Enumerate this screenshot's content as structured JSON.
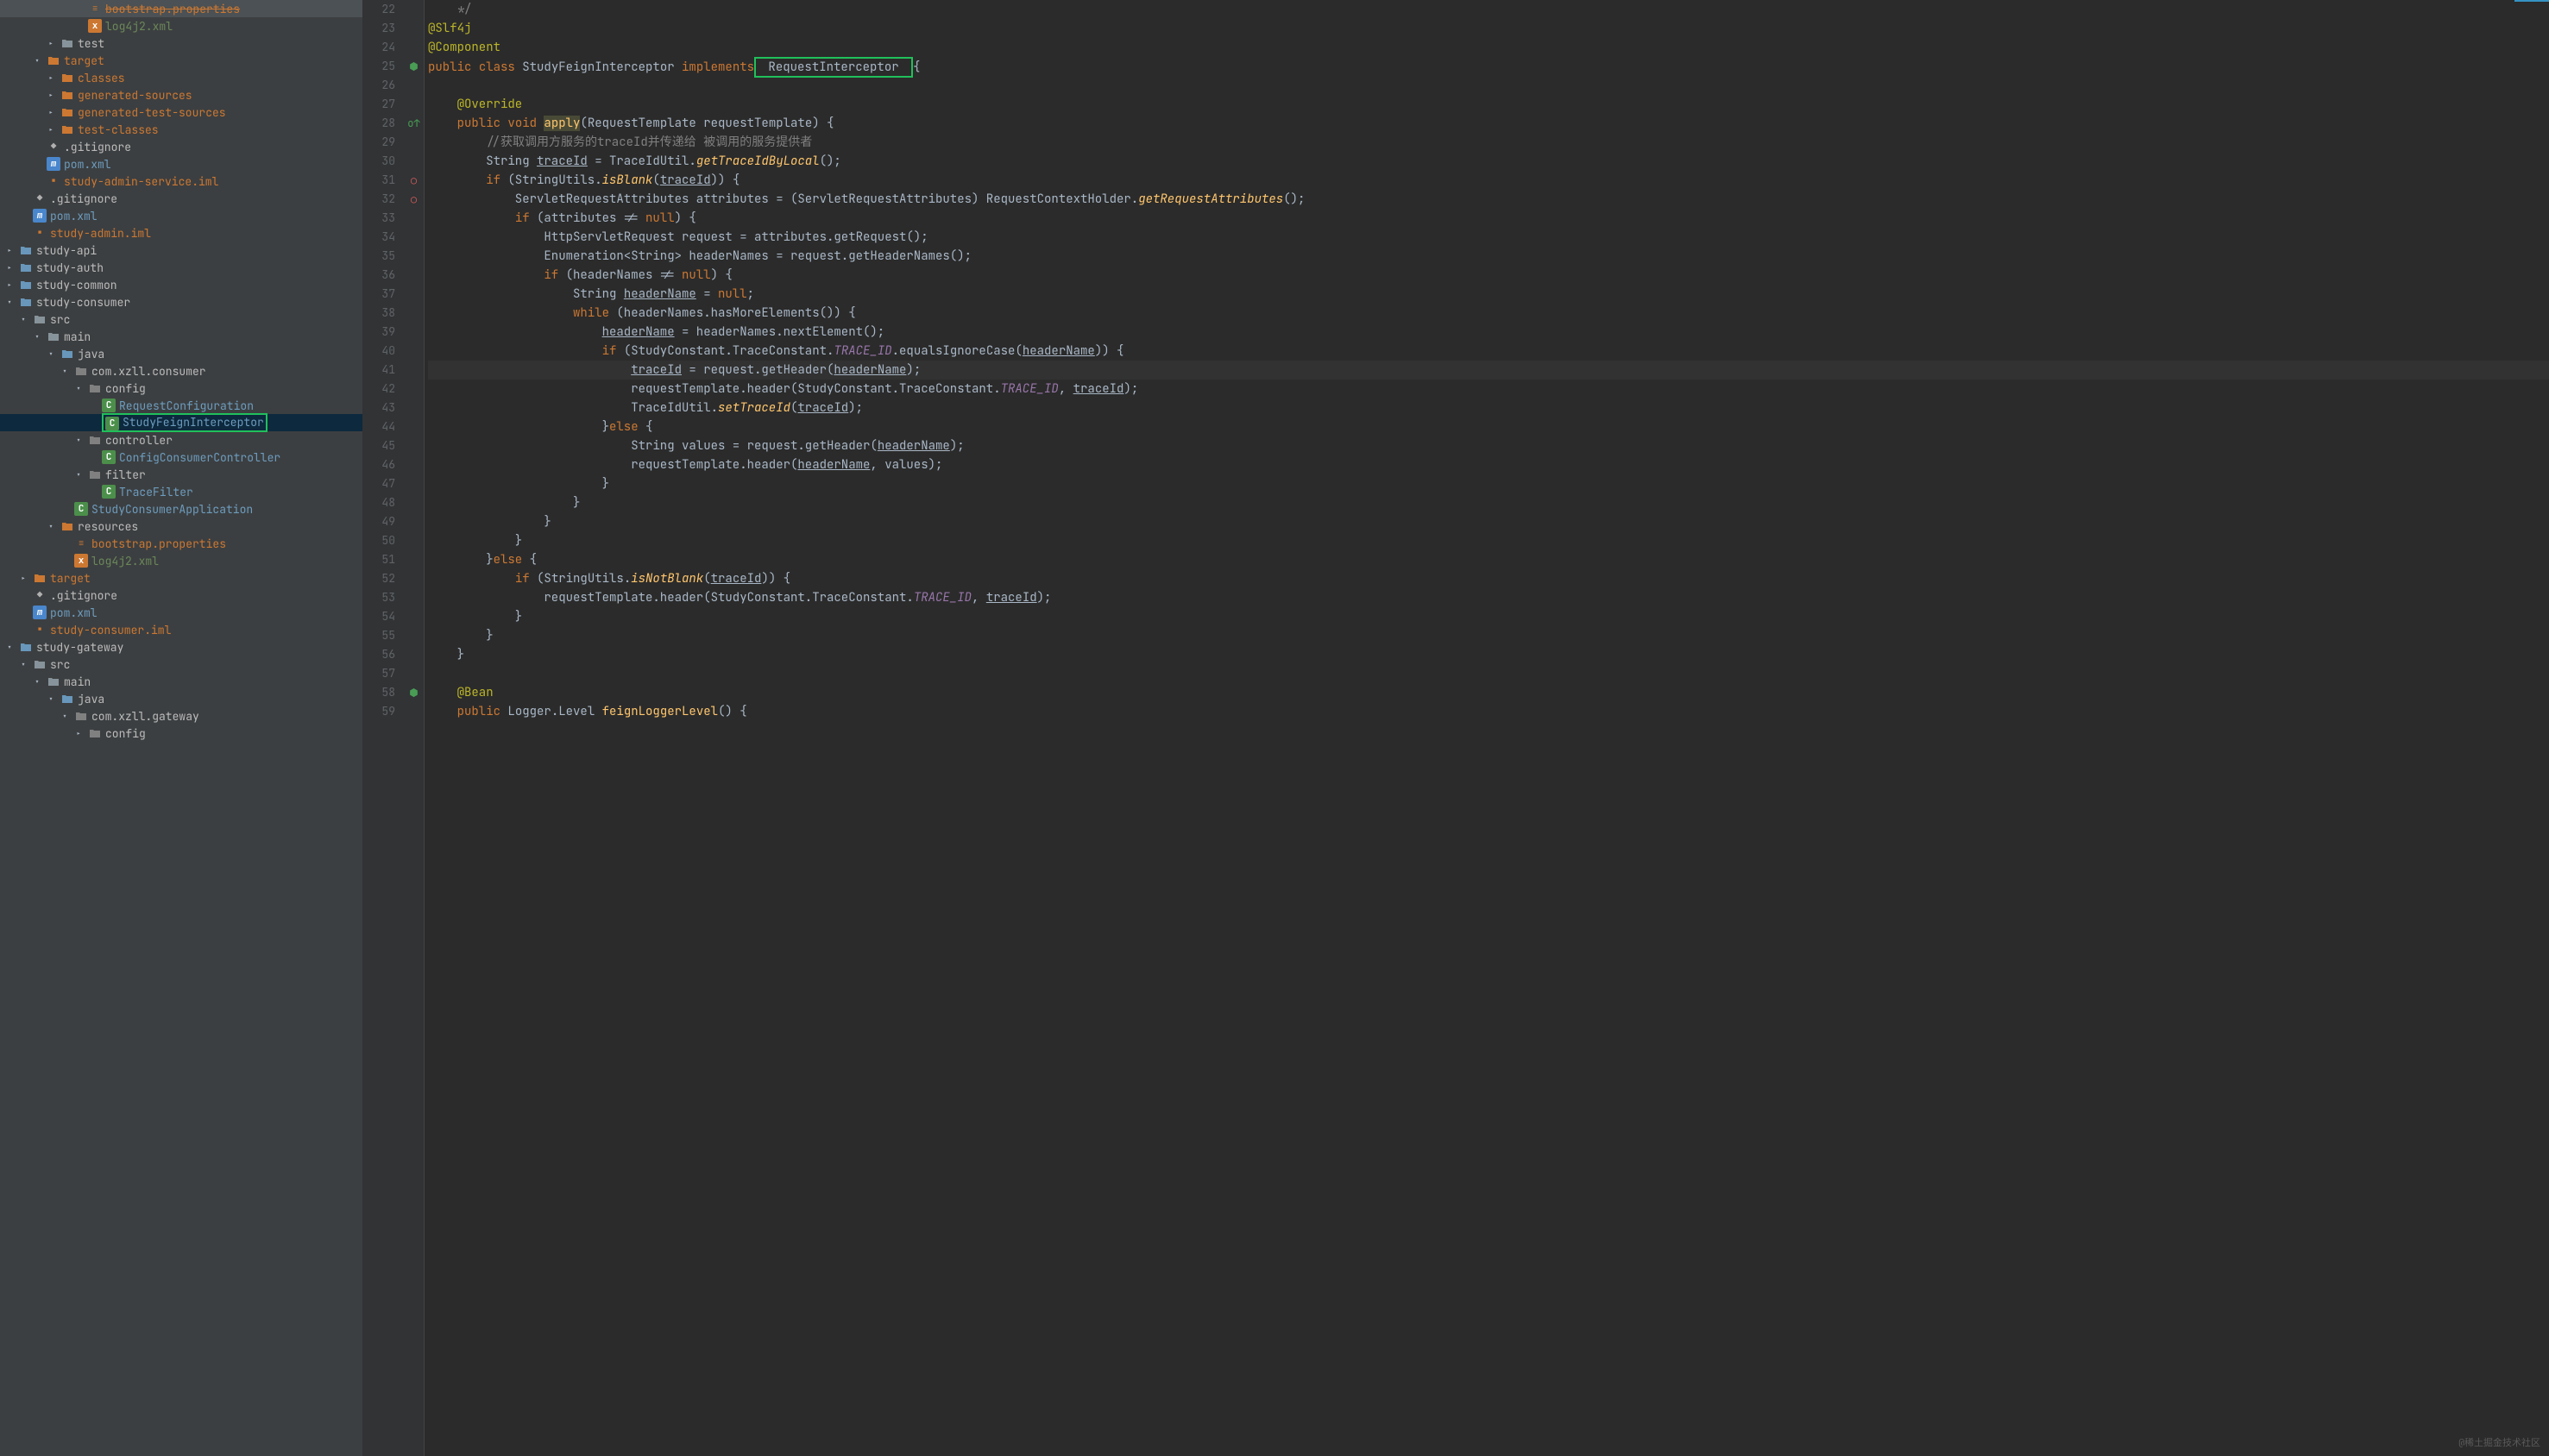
{
  "tree": [
    {
      "indent": 5,
      "arrow": "",
      "icon": "props",
      "label": "bootstrap.properties",
      "cls": "orange",
      "cut": true
    },
    {
      "indent": 5,
      "arrow": "",
      "icon": "xml",
      "label": "log4j2.xml",
      "cls": "teal"
    },
    {
      "indent": 3,
      "arrow": ">",
      "icon": "folder",
      "label": "test",
      "cls": ""
    },
    {
      "indent": 2,
      "arrow": "v",
      "icon": "folder-red",
      "label": "target",
      "cls": "orange"
    },
    {
      "indent": 3,
      "arrow": ">",
      "icon": "folder-red",
      "label": "classes",
      "cls": "orange"
    },
    {
      "indent": 3,
      "arrow": ">",
      "icon": "folder-red",
      "label": "generated-sources",
      "cls": "orange"
    },
    {
      "indent": 3,
      "arrow": ">",
      "icon": "folder-red",
      "label": "generated-test-sources",
      "cls": "orange"
    },
    {
      "indent": 3,
      "arrow": ">",
      "icon": "folder-red",
      "label": "test-classes",
      "cls": "orange"
    },
    {
      "indent": 2,
      "arrow": "",
      "icon": "git",
      "label": ".gitignore",
      "cls": ""
    },
    {
      "indent": 2,
      "arrow": "",
      "icon": "maven",
      "label": "pom.xml",
      "cls": "blue"
    },
    {
      "indent": 2,
      "arrow": "",
      "icon": "iml",
      "label": "study-admin-service.iml",
      "cls": "orange"
    },
    {
      "indent": 1,
      "arrow": "",
      "icon": "git",
      "label": ".gitignore",
      "cls": ""
    },
    {
      "indent": 1,
      "arrow": "",
      "icon": "maven",
      "label": "pom.xml",
      "cls": "blue"
    },
    {
      "indent": 1,
      "arrow": "",
      "icon": "iml",
      "label": "study-admin.iml",
      "cls": "orange"
    },
    {
      "indent": 0,
      "arrow": ">",
      "icon": "module",
      "label": "study-api",
      "cls": ""
    },
    {
      "indent": 0,
      "arrow": ">",
      "icon": "module",
      "label": "study-auth",
      "cls": ""
    },
    {
      "indent": 0,
      "arrow": ">",
      "icon": "module",
      "label": "study-common",
      "cls": ""
    },
    {
      "indent": 0,
      "arrow": "v",
      "icon": "module",
      "label": "study-consumer",
      "cls": ""
    },
    {
      "indent": 1,
      "arrow": "v",
      "icon": "folder",
      "label": "src",
      "cls": ""
    },
    {
      "indent": 2,
      "arrow": "v",
      "icon": "folder",
      "label": "main",
      "cls": ""
    },
    {
      "indent": 3,
      "arrow": "v",
      "icon": "folder-blue",
      "label": "java",
      "cls": ""
    },
    {
      "indent": 4,
      "arrow": "v",
      "icon": "folder-gray",
      "label": "com.xzll.consumer",
      "cls": ""
    },
    {
      "indent": 5,
      "arrow": "v",
      "icon": "folder-gray",
      "label": "config",
      "cls": ""
    },
    {
      "indent": 6,
      "arrow": "",
      "icon": "class",
      "label": "RequestConfiguration",
      "cls": "blue",
      "box": "top"
    },
    {
      "indent": 6,
      "arrow": "",
      "icon": "class",
      "label": "StudyFeignInterceptor",
      "cls": "blue",
      "selected": true,
      "box": "main"
    },
    {
      "indent": 5,
      "arrow": "v",
      "icon": "folder-gray",
      "label": "controller",
      "cls": ""
    },
    {
      "indent": 6,
      "arrow": "",
      "icon": "class",
      "label": "ConfigConsumerController",
      "cls": "blue"
    },
    {
      "indent": 5,
      "arrow": "v",
      "icon": "folder-gray",
      "label": "filter",
      "cls": ""
    },
    {
      "indent": 6,
      "arrow": "",
      "icon": "class",
      "label": "TraceFilter",
      "cls": "blue"
    },
    {
      "indent": 4,
      "arrow": "",
      "icon": "class",
      "label": "StudyConsumerApplication",
      "cls": "blue"
    },
    {
      "indent": 3,
      "arrow": "v",
      "icon": "folder-red",
      "label": "resources",
      "cls": ""
    },
    {
      "indent": 4,
      "arrow": "",
      "icon": "props",
      "label": "bootstrap.properties",
      "cls": "orange"
    },
    {
      "indent": 4,
      "arrow": "",
      "icon": "xml",
      "label": "log4j2.xml",
      "cls": "teal"
    },
    {
      "indent": 1,
      "arrow": ">",
      "icon": "folder-red",
      "label": "target",
      "cls": "orange"
    },
    {
      "indent": 1,
      "arrow": "",
      "icon": "git",
      "label": ".gitignore",
      "cls": ""
    },
    {
      "indent": 1,
      "arrow": "",
      "icon": "maven",
      "label": "pom.xml",
      "cls": "blue"
    },
    {
      "indent": 1,
      "arrow": "",
      "icon": "iml",
      "label": "study-consumer.iml",
      "cls": "orange"
    },
    {
      "indent": 0,
      "arrow": "v",
      "icon": "module",
      "label": "study-gateway",
      "cls": ""
    },
    {
      "indent": 1,
      "arrow": "v",
      "icon": "folder",
      "label": "src",
      "cls": ""
    },
    {
      "indent": 2,
      "arrow": "v",
      "icon": "folder",
      "label": "main",
      "cls": ""
    },
    {
      "indent": 3,
      "arrow": "v",
      "icon": "folder-blue",
      "label": "java",
      "cls": ""
    },
    {
      "indent": 4,
      "arrow": "v",
      "icon": "folder-gray",
      "label": "com.xzll.gateway",
      "cls": ""
    },
    {
      "indent": 5,
      "arrow": ">",
      "icon": "folder-gray",
      "label": "config",
      "cls": ""
    }
  ],
  "icons": {
    "folder": "▸",
    "folder-red": "▸",
    "folder-blue": "▸",
    "folder-gray": "▸",
    "module": "▸",
    "xml": "x",
    "maven": "m",
    "git": "◆",
    "iml": "▪",
    "props": "≡",
    "class": "C"
  },
  "gutter_start": 22,
  "gutter_end": 59,
  "marks": {
    "25": {
      "sym": "⬢",
      "cls": "mark-green"
    },
    "28": {
      "sym": "o↑",
      "cls": "mark-override"
    },
    "31": {
      "sym": "○",
      "cls": "mark-red"
    },
    "32": {
      "sym": "○",
      "cls": "mark-red"
    },
    "58": {
      "sym": "⬢",
      "cls": "mark-green"
    }
  },
  "current_line": 41,
  "code": {
    "22": [
      [
        "c",
        "    */"
      ]
    ],
    "23": [
      [
        "an",
        "@Slf4j"
      ]
    ],
    "24": [
      [
        "an",
        "@Component"
      ]
    ],
    "25": [
      [
        "k",
        "public "
      ],
      [
        "k",
        "class "
      ],
      [
        "t",
        "StudyFeignInterceptor "
      ],
      [
        "k",
        "implements"
      ],
      [
        "box",
        " RequestInterceptor "
      ],
      [
        "t",
        "{"
      ]
    ],
    "26": [],
    "27": [
      [
        "t",
        "    "
      ],
      [
        "an",
        "@Override"
      ]
    ],
    "28": [
      [
        "t",
        "    "
      ],
      [
        "k",
        "public "
      ],
      [
        "k",
        "void "
      ],
      [
        "mc hl",
        "apply"
      ],
      [
        "t",
        "(RequestTemplate requestTemplate) {"
      ]
    ],
    "29": [
      [
        "t",
        "        "
      ],
      [
        "c",
        "//获取调用方服务的traceId并传递给 被调用的服务提供者"
      ]
    ],
    "30": [
      [
        "t",
        "        String "
      ],
      [
        "t u",
        "traceId"
      ],
      [
        "t",
        " = TraceIdUtil."
      ],
      [
        "m",
        "getTraceIdByLocal"
      ],
      [
        "t",
        "();"
      ]
    ],
    "31": [
      [
        "t",
        "        "
      ],
      [
        "k",
        "if "
      ],
      [
        "t",
        "(StringUtils."
      ],
      [
        "m",
        "isBlank"
      ],
      [
        "t",
        "("
      ],
      [
        "t u",
        "traceId"
      ],
      [
        "t",
        ")) {"
      ]
    ],
    "32": [
      [
        "t",
        "            ServletRequestAttributes attributes = (ServletRequestAttributes) RequestContextHolder."
      ],
      [
        "m",
        "getRequestAttributes"
      ],
      [
        "t",
        "();"
      ]
    ],
    "33": [
      [
        "t",
        "            "
      ],
      [
        "k",
        "if "
      ],
      [
        "t",
        "(attributes != "
      ],
      [
        "k",
        "null"
      ],
      [
        "t",
        ") {"
      ]
    ],
    "34": [
      [
        "t",
        "                HttpServletRequest request = attributes.getRequest();"
      ]
    ],
    "35": [
      [
        "t",
        "                Enumeration<String> headerNames = request.getHeaderNames();"
      ]
    ],
    "36": [
      [
        "t",
        "                "
      ],
      [
        "k",
        "if "
      ],
      [
        "t",
        "(headerNames != "
      ],
      [
        "k",
        "null"
      ],
      [
        "t",
        ") {"
      ]
    ],
    "37": [
      [
        "t",
        "                    String "
      ],
      [
        "t u",
        "headerName"
      ],
      [
        "t",
        " = "
      ],
      [
        "k",
        "null"
      ],
      [
        "t",
        ";"
      ]
    ],
    "38": [
      [
        "t",
        "                    "
      ],
      [
        "k",
        "while "
      ],
      [
        "t",
        "(headerNames.hasMoreElements()) {"
      ]
    ],
    "39": [
      [
        "t",
        "                        "
      ],
      [
        "t u",
        "headerName"
      ],
      [
        "t",
        " = headerNames.nextElement();"
      ]
    ],
    "40": [
      [
        "t",
        "                        "
      ],
      [
        "k",
        "if "
      ],
      [
        "t",
        "(StudyConstant.TraceConstant."
      ],
      [
        "fi",
        "TRACE_ID"
      ],
      [
        "t",
        ".equalsIgnoreCase("
      ],
      [
        "t u",
        "headerName"
      ],
      [
        "t",
        ")) {"
      ]
    ],
    "41": [
      [
        "t",
        "                            "
      ],
      [
        "t u",
        "traceId"
      ],
      [
        "t",
        " = request.getHeader("
      ],
      [
        "t u",
        "headerName"
      ],
      [
        "t",
        ");"
      ]
    ],
    "42": [
      [
        "t",
        "                            requestTemplate.header(StudyConstant.TraceConstant."
      ],
      [
        "fi",
        "TRACE_ID"
      ],
      [
        "t",
        ", "
      ],
      [
        "t u",
        "traceId"
      ],
      [
        "t",
        ");"
      ]
    ],
    "43": [
      [
        "t",
        "                            TraceIdUtil."
      ],
      [
        "m",
        "setTraceId"
      ],
      [
        "t",
        "("
      ],
      [
        "t u",
        "traceId"
      ],
      [
        "t",
        ");"
      ]
    ],
    "44": [
      [
        "t",
        "                        }"
      ],
      [
        "k",
        "else "
      ],
      [
        "t",
        "{"
      ]
    ],
    "45": [
      [
        "t",
        "                            String values = request.getHeader("
      ],
      [
        "t u",
        "headerName"
      ],
      [
        "t",
        ");"
      ]
    ],
    "46": [
      [
        "t",
        "                            requestTemplate.header("
      ],
      [
        "t u",
        "headerName"
      ],
      [
        "t",
        ", values);"
      ]
    ],
    "47": [
      [
        "t",
        "                        }"
      ]
    ],
    "48": [
      [
        "t",
        "                    }"
      ]
    ],
    "49": [
      [
        "t",
        "                }"
      ]
    ],
    "50": [
      [
        "t",
        "            }"
      ]
    ],
    "51": [
      [
        "t",
        "        }"
      ],
      [
        "k",
        "else "
      ],
      [
        "t",
        "{"
      ]
    ],
    "52": [
      [
        "t",
        "            "
      ],
      [
        "k",
        "if "
      ],
      [
        "t",
        "(StringUtils."
      ],
      [
        "m",
        "isNotBlank"
      ],
      [
        "t",
        "("
      ],
      [
        "t u",
        "traceId"
      ],
      [
        "t",
        ")) {"
      ]
    ],
    "53": [
      [
        "t",
        "                requestTemplate.header(StudyConstant.TraceConstant."
      ],
      [
        "fi",
        "TRACE_ID"
      ],
      [
        "t",
        ", "
      ],
      [
        "t u",
        "traceId"
      ],
      [
        "t",
        ");"
      ]
    ],
    "54": [
      [
        "t",
        "            }"
      ]
    ],
    "55": [
      [
        "t",
        "        }"
      ]
    ],
    "56": [
      [
        "t",
        "    }"
      ]
    ],
    "57": [],
    "58": [
      [
        "t",
        "    "
      ],
      [
        "an",
        "@Bean"
      ]
    ],
    "59": [
      [
        "t",
        "    "
      ],
      [
        "k",
        "public "
      ],
      [
        "t",
        "Logger.Level "
      ],
      [
        "mc",
        "feignLoggerLevel"
      ],
      [
        "t",
        "() {"
      ]
    ]
  },
  "watermark": "@稀土掘金技术社区"
}
